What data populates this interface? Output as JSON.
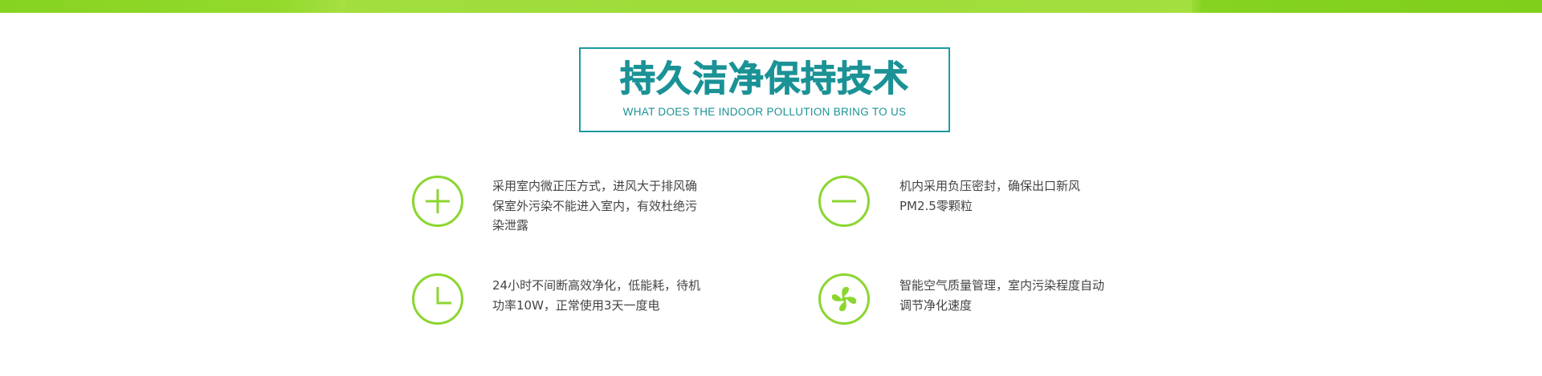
{
  "section": {
    "title": "持久洁净保持技术",
    "subtitle": "WHAT DOES THE INDOOR POLLUTION BRING TO US"
  },
  "colors": {
    "accent_green": "#8bd630",
    "title_teal": "#1b9296",
    "text_gray": "#444444",
    "top_band": "#9bdb35"
  },
  "features": [
    {
      "icon": "plus-icon",
      "text": "采用室内微正压方式，进风大于排风确\n保室外污染不能进入室内，有效杜绝污\n染泄露"
    },
    {
      "icon": "minus-icon",
      "text": "机内采用负压密封，确保出口新风\nPM2.5零颗粒"
    },
    {
      "icon": "clock-icon",
      "text": "24小时不间断高效净化，低能耗，待机\n功率10W，正常使用3天一度电"
    },
    {
      "icon": "fan-icon",
      "text": "智能空气质量管理，室内污染程度自动\n调节净化速度"
    }
  ]
}
